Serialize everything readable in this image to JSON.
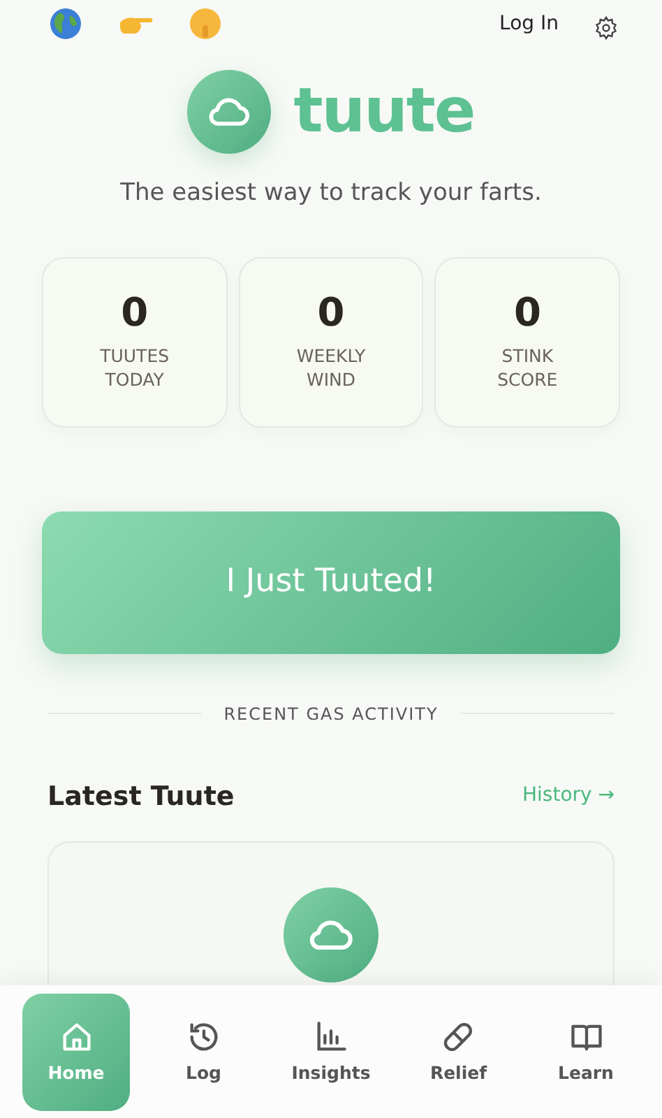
{
  "top_bar": {
    "login": "Log In"
  },
  "brand": {
    "name": "tuute",
    "tagline": "The easiest way to track your farts."
  },
  "stats": [
    {
      "value": "0",
      "label": "TUUTES TODAY"
    },
    {
      "value": "0",
      "label": "WEEKLY WIND"
    },
    {
      "value": "0",
      "label": "STINK SCORE"
    }
  ],
  "primary_button": "I Just Tuuted!",
  "divider_label": "RECENT GAS ACTIVITY",
  "latest": {
    "title": "Latest Tuute",
    "link": "History →"
  },
  "nav": [
    {
      "label": "Home",
      "selected": true
    },
    {
      "label": "Log",
      "selected": false
    },
    {
      "label": "Insights",
      "selected": false
    },
    {
      "label": "Relief",
      "selected": false
    },
    {
      "label": "Learn",
      "selected": false
    }
  ]
}
